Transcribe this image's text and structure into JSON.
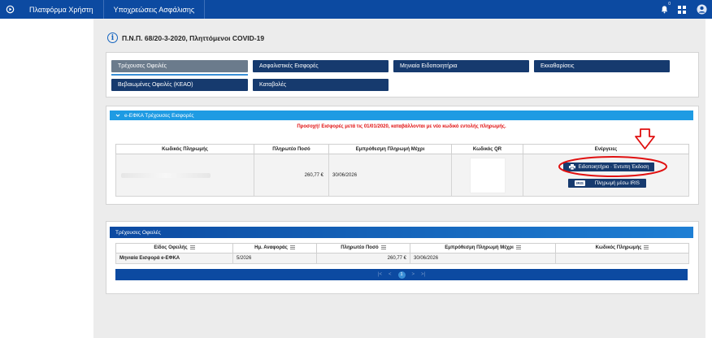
{
  "topbar": {
    "nav": [
      "Πλατφόρμα Χρήστη",
      "Υποχρεώσεις Ασφάλισης"
    ],
    "notification_count": "0",
    "icons": [
      "power-icon",
      "bell-icon",
      "grid-icon",
      "user-avatar-icon"
    ]
  },
  "page": {
    "title": "Π.Ν.Π. 68/20-3-2020, Πληττόμενοι COVID-19"
  },
  "tabs": [
    {
      "label": "Τρέχουσες Οφειλές",
      "active": true
    },
    {
      "label": "Ασφαλιστικές Εισφορές",
      "active": false
    },
    {
      "label": "Μηνιαία Ειδοποιητήρια",
      "active": false
    },
    {
      "label": "Εκκαθαρίσεις",
      "active": false
    },
    {
      "label": "Βεβαιωμένες Οφειλές (ΚΕΑΟ)",
      "active": false
    },
    {
      "label": "Καταβολές",
      "active": false
    }
  ],
  "efka_panel": {
    "header": "e-ΕΦΚΑ Τρέχουσες Εισφορές",
    "notice": "Προσοχή! Εισφορές μετά τις 01/01/2020, καταβάλλονται με νέο κωδικό εντολής πληρωμής.",
    "columns": [
      "Κωδικός Πληρωμής",
      "Πληρωτέο Ποσό",
      "Εμπρόθεσμη Πληρωμή Μέχρι",
      "Κωδικός QR",
      "Ενέργειες"
    ],
    "row": {
      "amount": "260,77 €",
      "due_date": "30/06/2026"
    },
    "print_button": "Ειδοποιητήριο · Έντυπη Έκδοση",
    "iris_badge": "IRIS",
    "iris_button": "Πληρωμή μέσω IRIS"
  },
  "debts_panel": {
    "header": "Τρέχουσες Οφειλές",
    "columns": [
      "Είδος Οφειλής",
      "Ημ. Αναφοράς",
      "Πληρωτέο Ποσό",
      "Εμπρόθεσμη Πληρωμή Μέχρι",
      "Κωδικός Πληρωμής"
    ],
    "rows": [
      {
        "type": "Μηνιαία Εισφορά e-ΕΦΚΑ",
        "ref_date": "5/2026",
        "amount": "260,77 €",
        "due_date": "30/06/2026",
        "code": ""
      }
    ],
    "pager": {
      "first": "|<",
      "prev": "<",
      "page": "1",
      "next": ">",
      "last": ">|"
    }
  },
  "colors": {
    "topbar": "#0c4aa1",
    "tab": "#163a6e",
    "tab_active": "#6b7b8c",
    "panel_header": "#1e9be3",
    "notice": "#e01010",
    "annotation": "#e01010"
  }
}
